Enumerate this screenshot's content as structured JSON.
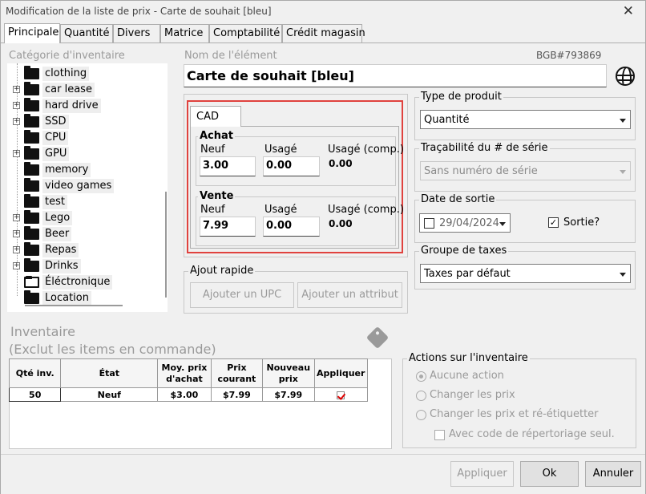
{
  "window": {
    "title": "Modification de la liste de prix - Carte de souhait [bleu]"
  },
  "tabs": [
    {
      "label": "Principale"
    },
    {
      "label": "Quantité"
    },
    {
      "label": "Divers"
    },
    {
      "label": "Matrice"
    },
    {
      "label": "Comptabilité"
    },
    {
      "label": "Crédit magasin"
    }
  ],
  "category": {
    "label": "Catégorie d'inventaire",
    "items": [
      {
        "label": "clothing",
        "expandable": false
      },
      {
        "label": "car lease",
        "expandable": true
      },
      {
        "label": "hard drive",
        "expandable": true
      },
      {
        "label": "SSD",
        "expandable": true
      },
      {
        "label": "CPU",
        "expandable": false
      },
      {
        "label": "GPU",
        "expandable": true
      },
      {
        "label": "memory",
        "expandable": false
      },
      {
        "label": "video games",
        "expandable": false
      },
      {
        "label": "test",
        "expandable": false
      },
      {
        "label": "Lego",
        "expandable": true
      },
      {
        "label": "Beer",
        "expandable": true
      },
      {
        "label": "Repas",
        "expandable": true
      },
      {
        "label": "Drinks",
        "expandable": true
      },
      {
        "label": "Éléctronique",
        "expandable": false
      },
      {
        "label": "Location",
        "expandable": false
      }
    ]
  },
  "item": {
    "name_label": "Nom de l'élément",
    "sku": "BGB#793869",
    "name_value": "Carte de souhait [bleu]"
  },
  "pricing": {
    "currency_tab": "CAD",
    "purchase": {
      "title": "Achat",
      "new_label": "Neuf",
      "used_label": "Usagé",
      "used_comp_label": "Usagé (comp.)",
      "new_value": "3.00",
      "used_value": "0.00",
      "used_comp_value": "0.00"
    },
    "sale": {
      "title": "Vente",
      "new_label": "Neuf",
      "used_label": "Usagé",
      "used_comp_label": "Usagé (comp.)",
      "new_value": "7.99",
      "used_value": "0.00",
      "used_comp_value": "0.00"
    }
  },
  "quick_add": {
    "title": "Ajout rapide",
    "add_upc": "Ajouter un UPC",
    "add_attribute": "Ajouter un attribut"
  },
  "product_type": {
    "title": "Type de produit",
    "value": "Quantité"
  },
  "serial_tracking": {
    "title": "Traçabilité du # de série",
    "value": "Sans numéro de série"
  },
  "release_date": {
    "title": "Date de sortie",
    "date": "29/04/2024",
    "released_label": "Sortie?",
    "released_checked": "✓"
  },
  "tax_group": {
    "title": "Groupe de taxes",
    "value": "Taxes par défaut"
  },
  "inventory": {
    "title": "Inventaire",
    "subtitle": "(Exclut les items en commande)",
    "columns": [
      "Qté inv.",
      "État",
      "Moy. prix d'achat",
      "Prix courant",
      "Nouveau prix",
      "Appliquer"
    ],
    "rows": [
      {
        "qty": "50",
        "state": "Neuf",
        "avg_cost": "$3.00",
        "current_price": "$7.99",
        "new_price": "$7.99"
      }
    ]
  },
  "inventory_actions": {
    "title": "Actions sur l'inventaire",
    "no_action": "Aucune action",
    "change_prices": "Changer les prix",
    "change_and_relabel": "Changer les prix et ré-étiquetter",
    "with_code_only": "Avec code de répertoriage seul."
  },
  "footer": {
    "apply": "Appliquer",
    "ok": "Ok",
    "cancel": "Annuler"
  }
}
